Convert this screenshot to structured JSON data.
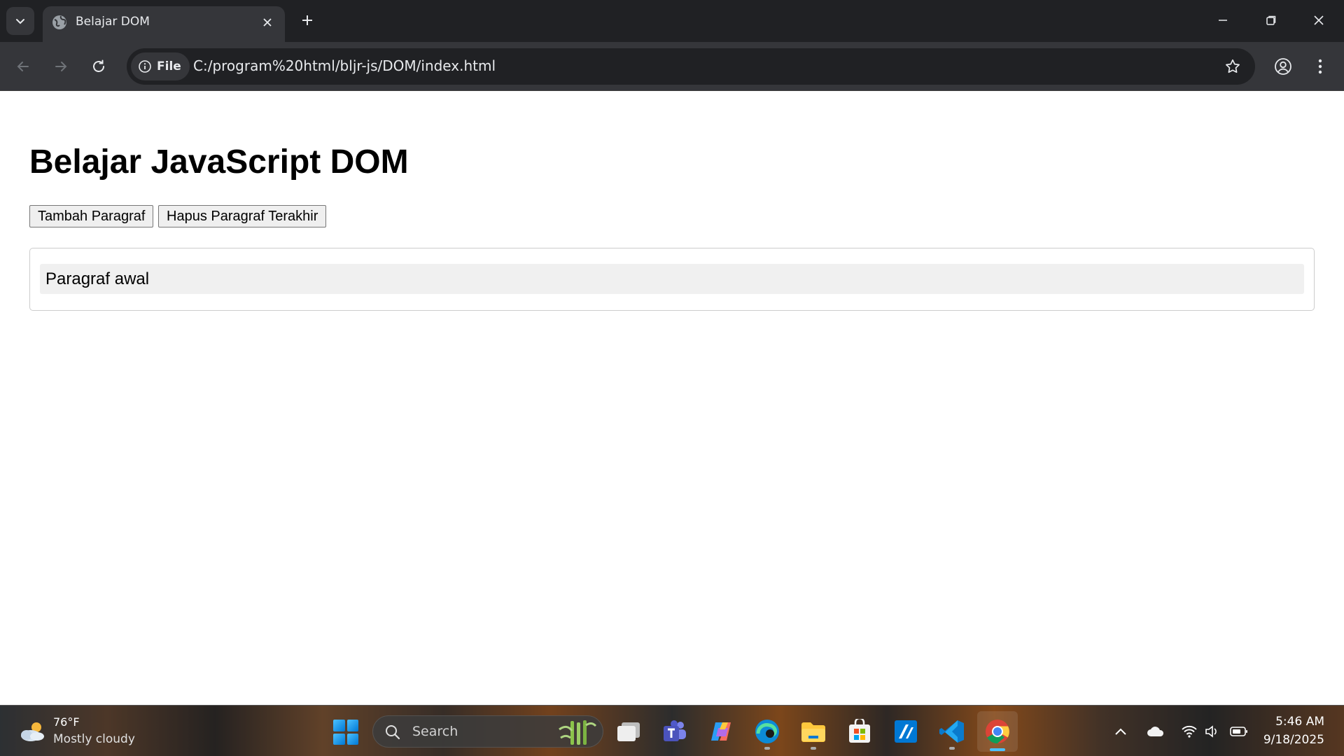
{
  "browser": {
    "tab": {
      "title": "Belajar DOM",
      "favicon": "globe-icon"
    },
    "address_bar": {
      "chip_label": "File",
      "url": "C:/program%20html/bljr-js/DOM/index.html"
    }
  },
  "page": {
    "heading": "Belajar JavaScript DOM",
    "buttons": {
      "add_label": "Tambah Paragraf",
      "remove_label": "Hapus Paragraf Terakhir"
    },
    "paragraphs": [
      "Paragraf awal"
    ]
  },
  "taskbar": {
    "weather": {
      "temp": "76°F",
      "desc": "Mostly cloudy"
    },
    "search_label": "Search",
    "apps": [
      "task-view",
      "teams",
      "copilot",
      "edge",
      "file-explorer",
      "microsoft-store",
      "azure-data-studio",
      "vscode",
      "chrome"
    ],
    "clock": {
      "time": "5:46 AM",
      "date": "9/18/2025"
    }
  },
  "colors": {
    "chrome_dark": "#202124",
    "chrome_toolbar": "#35363a",
    "paragraph_bg": "#f0f0f0",
    "container_border": "#cccccc",
    "accent": "#4cc2ff"
  }
}
